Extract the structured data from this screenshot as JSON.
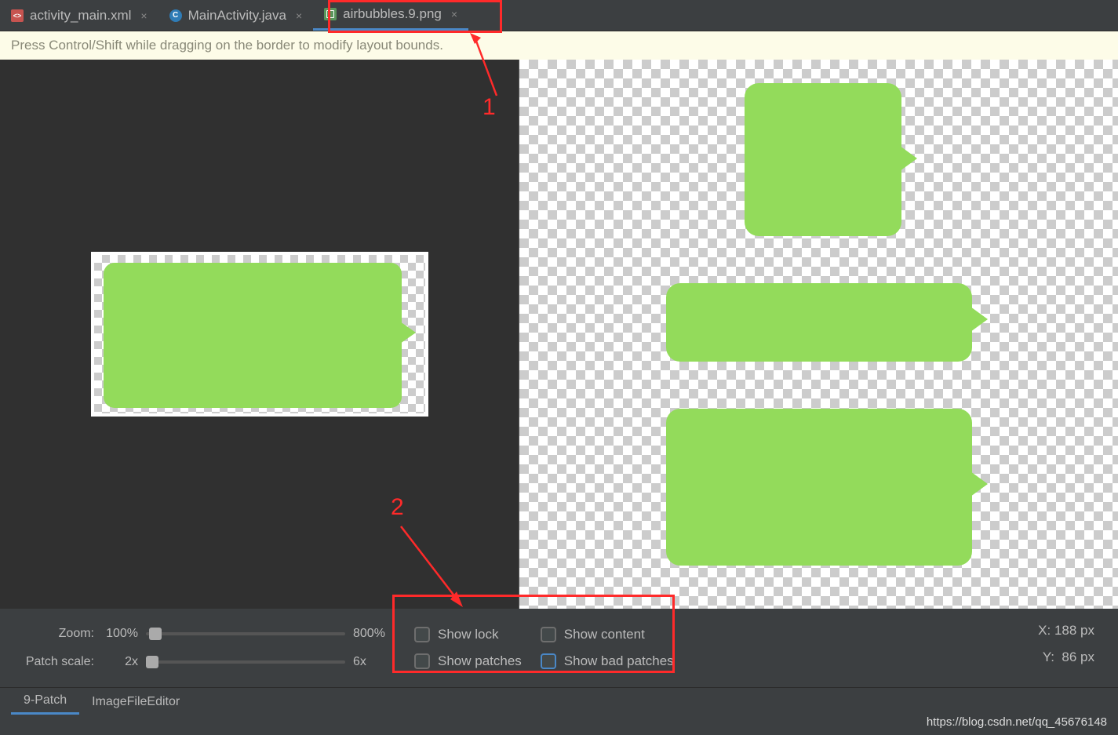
{
  "tabs": [
    {
      "label": "activity_main.xml",
      "icon": "xml"
    },
    {
      "label": "MainActivity.java",
      "icon": "java"
    },
    {
      "label": "airbubbles.9.png",
      "icon": "png",
      "active": true
    }
  ],
  "hint": "Press Control/Shift while dragging on the border to modify layout bounds.",
  "sliders": {
    "zoom": {
      "label": "Zoom:",
      "min_label": "100%",
      "max_label": "800%"
    },
    "patch_scale": {
      "label": "Patch scale:",
      "min_label": "2x",
      "max_label": "6x"
    }
  },
  "checkboxes": {
    "show_lock": "Show lock",
    "show_content": "Show content",
    "show_patches": "Show patches",
    "show_bad_patches": "Show bad patches"
  },
  "coords": {
    "x_label": "X:",
    "x_value": "188 px",
    "y_label": "Y:",
    "y_value": "86 px"
  },
  "subtabs": {
    "nine_patch": "9-Patch",
    "image_editor": "ImageFileEditor"
  },
  "annotations": {
    "num1": "1",
    "num2": "2"
  },
  "watermark": "https://blog.csdn.net/qq_45676148"
}
